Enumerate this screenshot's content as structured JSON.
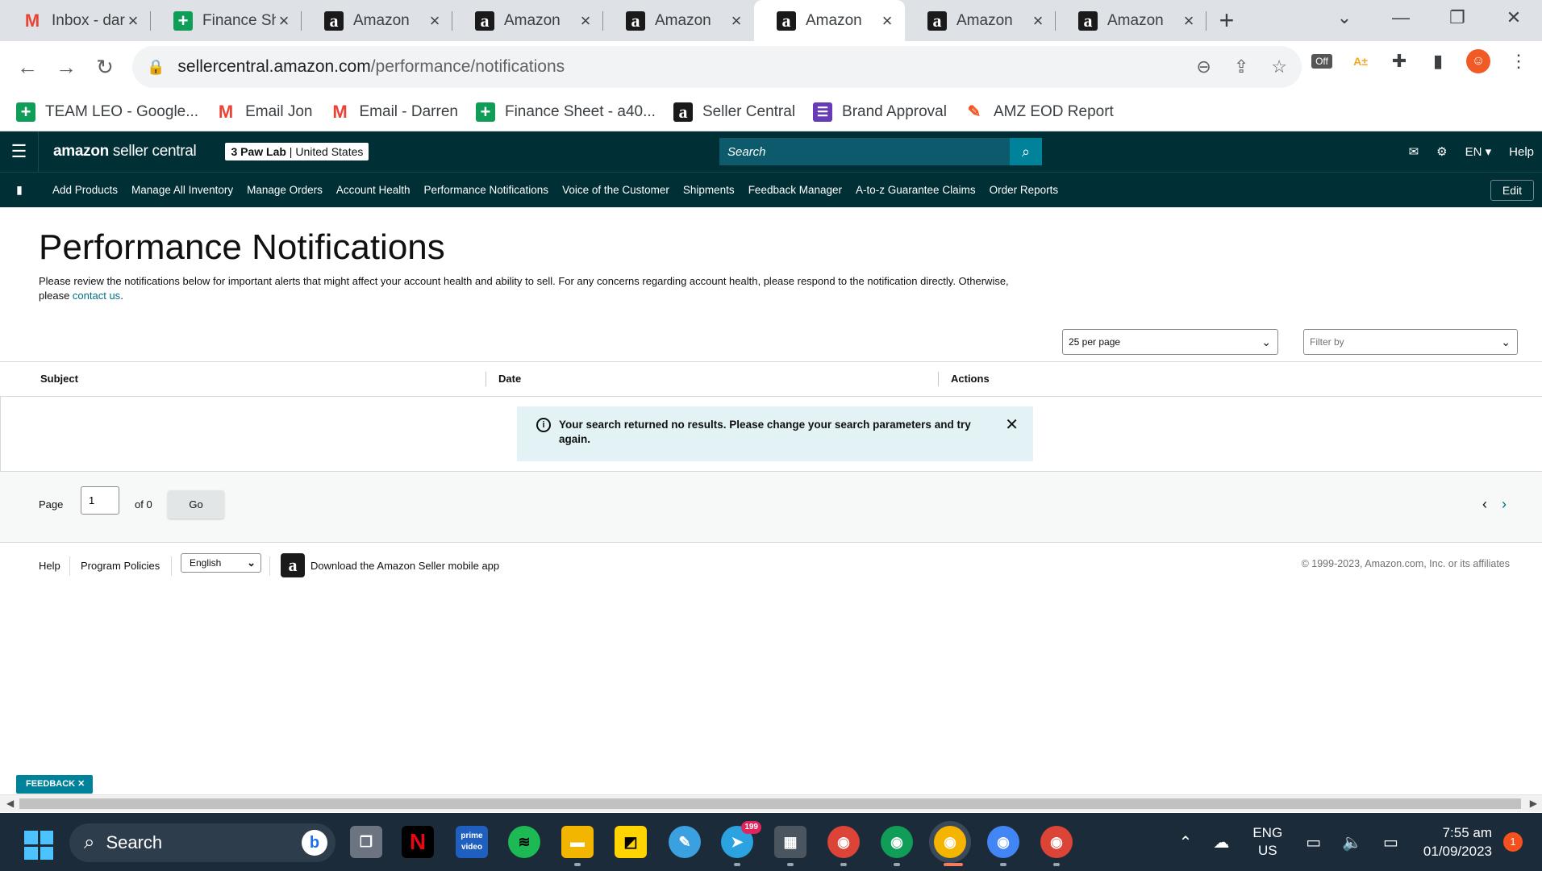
{
  "browser": {
    "tabs": [
      {
        "title": "Inbox - darren",
        "icon": "gmail-icon"
      },
      {
        "title": "Finance Sheet",
        "icon": "sheets-icon"
      },
      {
        "title": "Amazon",
        "icon": "amazon-icon"
      },
      {
        "title": "Amazon",
        "icon": "amazon-icon"
      },
      {
        "title": "Amazon",
        "icon": "amazon-icon"
      },
      {
        "title": "Amazon",
        "icon": "amazon-icon"
      },
      {
        "title": "Amazon",
        "icon": "amazon-icon"
      },
      {
        "title": "Amazon",
        "icon": "amazon-icon"
      }
    ],
    "active_tab": 5,
    "url_host": "sellercentral.amazon.com",
    "url_path": "/performance/notifications",
    "bookmarks": [
      {
        "label": "TEAM LEO - Google...",
        "icon": "sheets-icon"
      },
      {
        "label": "Email Jon",
        "icon": "gmail-icon"
      },
      {
        "label": "Email - Darren",
        "icon": "gmail-icon"
      },
      {
        "label": "Finance Sheet - a40...",
        "icon": "sheets-icon"
      },
      {
        "label": "Seller Central",
        "icon": "amazon-icon"
      },
      {
        "label": "Brand Approval",
        "icon": "list-icon"
      },
      {
        "label": "AMZ EOD Report",
        "icon": "eod-icon"
      }
    ],
    "ext_off_label": "Off",
    "ext_scout_label": "A±"
  },
  "seller": {
    "logo_brand": "amazon",
    "logo_product": " seller central",
    "store_name": "3 Paw Lab",
    "store_region": "United States",
    "search_placeholder": "Search",
    "lang": "EN ▾",
    "help": "Help",
    "nav": [
      "Add Products",
      "Manage All Inventory",
      "Manage Orders",
      "Account Health",
      "Performance Notifications",
      "Voice of the Customer",
      "Shipments",
      "Feedback Manager",
      "A-to-z Guarantee Claims",
      "Order Reports"
    ],
    "edit": "Edit"
  },
  "page": {
    "title": "Performance Notifications",
    "intro_text": "Please review the notifications below for important alerts that might affect your account health and ability to sell. For any concerns regarding account health, please respond to the notification directly. Otherwise, please ",
    "intro_link": "contact us",
    "intro_end": ".",
    "per_page": "25 per page",
    "filter_placeholder": "Filter by",
    "columns": [
      "Subject",
      "Date",
      "Actions"
    ],
    "alert": "Your search returned no results. Please change your search parameters and try again.",
    "pager": {
      "page_label": "Page",
      "page_value": "1",
      "of_label": "of 0",
      "go": "Go"
    }
  },
  "footer": {
    "help": "Help",
    "policies": "Program Policies",
    "language": "English",
    "app_download": "Download the Amazon Seller mobile app",
    "copyright": "© 1999-2023, Amazon.com, Inc. or its affiliates"
  },
  "feedback": "FEEDBACK ✕",
  "taskbar": {
    "search": "Search",
    "telegram_badge": "199",
    "lang_top": "ENG",
    "lang_bottom": "US",
    "time": "7:55 am",
    "date": "01/09/2023",
    "notifications": "1"
  }
}
